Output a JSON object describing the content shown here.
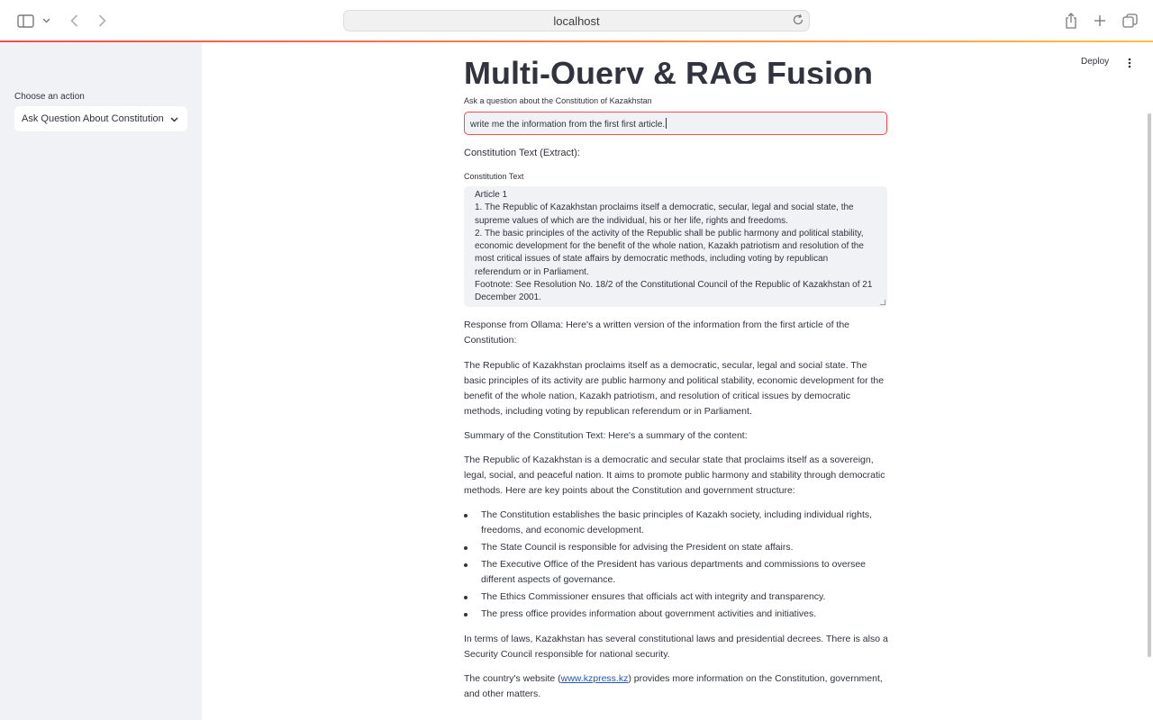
{
  "browser": {
    "url": "localhost"
  },
  "sidebar": {
    "label": "Choose an action",
    "selected": "Ask Question About Constitution"
  },
  "header": {
    "deploy_label": "Deploy"
  },
  "main": {
    "title": "Multi-Query & RAG Fusion",
    "question_label": "Ask a question about the Constitution of Kazakhstan",
    "question_value": "write me the information from the first first article.",
    "extract_heading": "Constitution Text (Extract):",
    "textarea_label": "Constitution Text",
    "textarea_lines": [
      "Article 1",
      "1. The Republic of Kazakhstan proclaims itself a democratic, secular, legal and social state, the supreme values of which are the individual, his or her life, rights and freedoms.",
      "2. The basic principles of the activity of the Republic shall be public harmony and political stability, economic development for the benefit of the whole nation, Kazakh patriotism and resolution of the most critical issues of state affairs by democratic methods, including voting by republican referendum or in Parliament.",
      "Footnote: See Resolution No. 18/2 of the Constitutional Council of the Republic of Kazakhstan of 21 December 2001."
    ],
    "response_intro": "Response from Ollama: Here's a written version of the information from the first article of the Constitution:",
    "response_body": "The Republic of Kazakhstan proclaims itself as a democratic, secular, legal and social state. The basic principles of its activity are public harmony and political stability, economic development for the benefit of the whole nation, Kazakh patriotism, and resolution of critical issues by democratic methods, including voting by republican referendum or in Parliament.",
    "summary_intro": "Summary of the Constitution Text: Here's a summary of the content:",
    "summary_body": "The Republic of Kazakhstan is a democratic and secular state that proclaims itself as a sovereign, legal, social, and peaceful nation. It aims to promote public harmony and stability through democratic methods. Here are key points about the Constitution and government structure:",
    "bullets": [
      "The Constitution establishes the basic principles of Kazakh society, including individual rights, freedoms, and economic development.",
      "The State Council is responsible for advising the President on state affairs.",
      "The Executive Office of the President has various departments and commissions to oversee different aspects of governance.",
      "The Ethics Commissioner ensures that officials act with integrity and transparency.",
      "The press office provides information about government activities and initiatives."
    ],
    "laws_para": "In terms of laws, Kazakhstan has several constitutional laws and presidential decrees. There is also a Security Council responsible for national security.",
    "website_before": "The country's website (",
    "website_link": "www.kzpress.kz",
    "website_after": ") provides more information on the Constitution, government, and other matters."
  }
}
